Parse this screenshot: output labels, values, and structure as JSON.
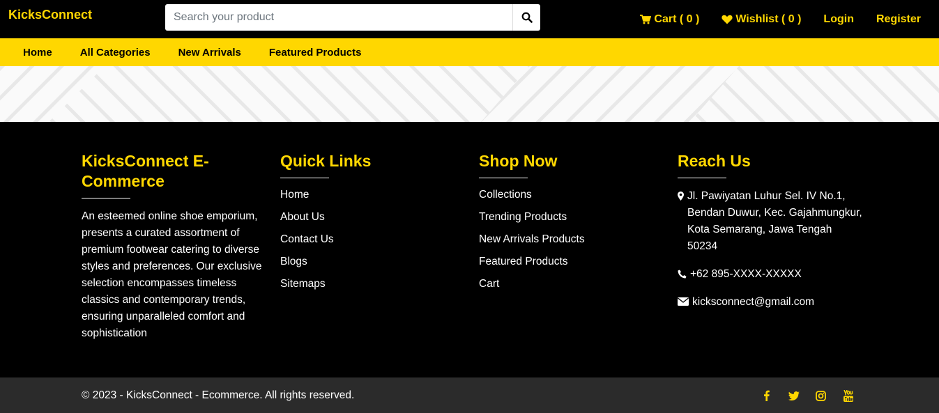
{
  "header": {
    "brand": "KicksConnect",
    "search": {
      "placeholder": "Search your product",
      "value": ""
    },
    "cart_label": "Cart ( 0 )",
    "wishlist_label": "Wishlist ( 0 )",
    "login_label": "Login",
    "register_label": "Register"
  },
  "nav": {
    "items": [
      {
        "label": "Home"
      },
      {
        "label": "All Categories"
      },
      {
        "label": "New Arrivals"
      },
      {
        "label": "Featured Products"
      }
    ]
  },
  "footer": {
    "about": {
      "title": "KicksConnect E-Commerce",
      "text": "An esteemed online shoe emporium, presents a curated assortment of premium footwear catering to diverse styles and preferences. Our exclusive selection encompasses timeless classics and contemporary trends, ensuring unparalleled comfort and sophistication"
    },
    "quick_links": {
      "title": "Quick Links",
      "links": [
        "Home",
        "About Us",
        "Contact Us",
        "Blogs",
        "Sitemaps"
      ]
    },
    "shop_now": {
      "title": "Shop Now",
      "links": [
        "Collections",
        "Trending Products",
        "New Arrivals Products",
        "Featured Products",
        "Cart"
      ]
    },
    "reach_us": {
      "title": "Reach Us",
      "address": "Jl. Pawiyatan Luhur Sel. IV No.1, Bendan Duwur, Kec. Gajahmungkur, Kota Semarang, Jawa Tengah 50234",
      "phone": "+62 895-XXXX-XXXXX",
      "email": "kicksconnect@gmail.com"
    },
    "copyright": "© 2023 - KicksConnect - Ecommerce. All rights reserved.",
    "socials": [
      "facebook-icon",
      "twitter-icon",
      "instagram-icon",
      "youtube-icon"
    ]
  },
  "colors": {
    "accent": "#ffd700",
    "background": "#000000",
    "bottom_bar": "#2b2b2b"
  }
}
